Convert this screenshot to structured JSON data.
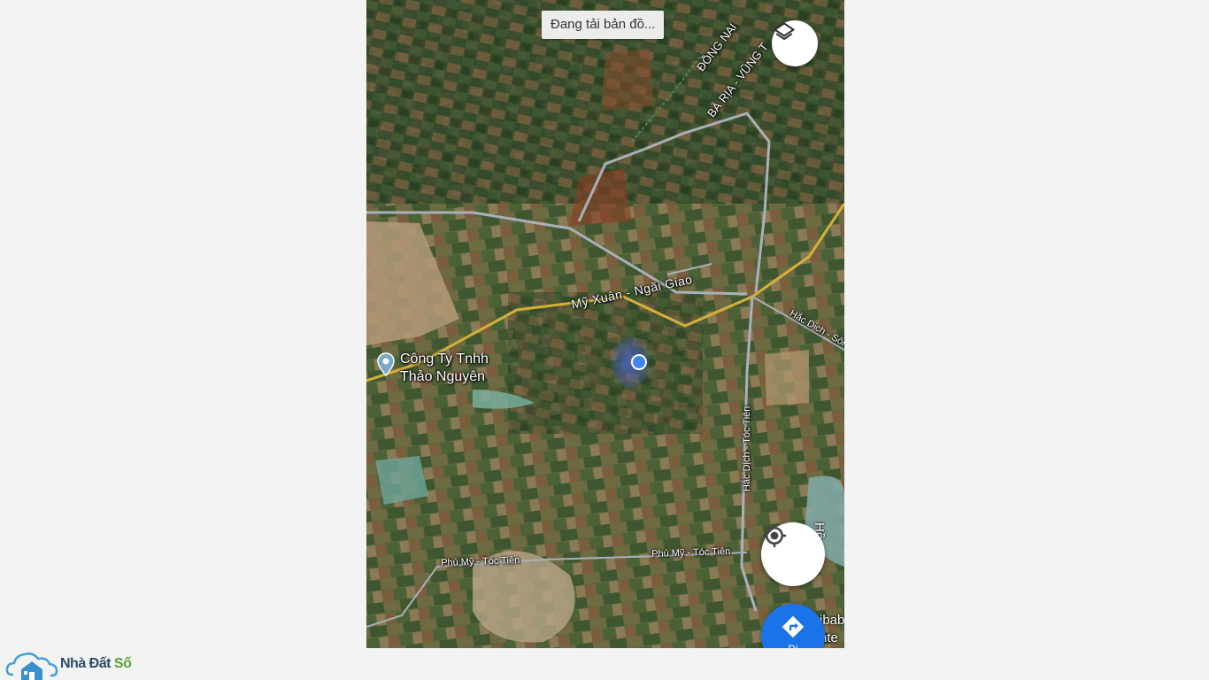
{
  "map": {
    "loading_text": "Đang tải bản đồ...",
    "province_label_1": "ĐỒNG NAI",
    "province_label_2": "BÀ RỊA - VŨNG T",
    "road_my_xuan": "Mỹ Xuân - Ngãi Giao",
    "road_hac_dich_song": "Hắc Dịch - Sông",
    "road_hac_dich_toc_tien": "Hắc Dịch - Tóc Tiên",
    "road_phu_my_toc_tien_1": "Phú Mỹ - Tóc Tiên",
    "road_phu_my_toc_tien_2": "Phú Mỹ - Tóc Tiên",
    "poi_name_line1": "Công Ty Tnhh",
    "poi_name_line2": "Thảo Nguyên",
    "right_edge_label_1": "Hồ",
    "right_edge_label_2": "ibab",
    "right_edge_label_3": "nte",
    "directions_label": "Đi",
    "icons": [
      "layers-icon",
      "my-location-icon",
      "directions-icon",
      "place-pin-icon"
    ],
    "colors": {
      "primary_blue": "#1a73e8",
      "location_dot": "#4285f4",
      "highway": "#d4b03a"
    }
  },
  "brand": {
    "part1": "Nhà Đất ",
    "part2": "Số",
    "icons": [
      "cloud-house-icon"
    ],
    "colors": {
      "brand_dark": "#2c4a63",
      "brand_green": "#5aa132"
    }
  }
}
